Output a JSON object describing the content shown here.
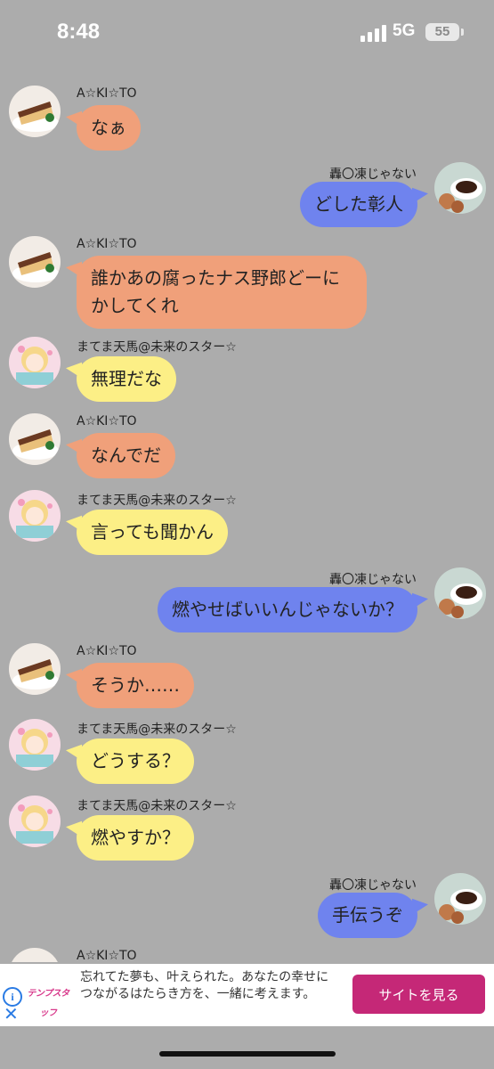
{
  "status_bar": {
    "time": "8:48",
    "network": "5G",
    "battery": "55"
  },
  "chat": {
    "messages": [
      {
        "side": "left",
        "sender": "A☆KI☆TO",
        "avatar": "cake",
        "text": "なぁ",
        "color": "orange"
      },
      {
        "side": "right",
        "sender": "轟〇凍じゃない",
        "avatar": "coffee",
        "text": "どした彰人",
        "color": "blue"
      },
      {
        "side": "left",
        "sender": "A☆KI☆TO",
        "avatar": "cake",
        "text": "誰かあの腐ったナス野郎どーにかしてくれ",
        "color": "orange"
      },
      {
        "side": "left",
        "sender": "まてま天馬@未来のスター☆",
        "avatar": "anime-girl",
        "text": "無理だな",
        "color": "yellow"
      },
      {
        "side": "left",
        "sender": "A☆KI☆TO",
        "avatar": "cake",
        "text": "なんでだ",
        "color": "orange"
      },
      {
        "side": "left",
        "sender": "まてま天馬@未来のスター☆",
        "avatar": "anime-girl",
        "text": "言っても聞かん",
        "color": "yellow"
      },
      {
        "side": "right",
        "sender": "轟〇凍じゃない",
        "avatar": "coffee",
        "text": "燃やせばいいんじゃないか？",
        "color": "blue"
      },
      {
        "side": "left",
        "sender": "A☆KI☆TO",
        "avatar": "cake",
        "text": "そうか……",
        "color": "orange"
      },
      {
        "side": "left",
        "sender": "まてま天馬@未来のスター☆",
        "avatar": "anime-girl",
        "text": "どうする？",
        "color": "yellow"
      },
      {
        "side": "left",
        "sender": "まてま天馬@未来のスター☆",
        "avatar": "anime-girl",
        "text": "燃やすか？",
        "color": "yellow"
      },
      {
        "side": "right",
        "sender": "轟〇凍じゃない",
        "avatar": "coffee",
        "text": "手伝うぞ",
        "color": "blue"
      },
      {
        "side": "left",
        "sender": "A☆KI☆TO",
        "avatar": "cake",
        "text": "",
        "color": "orange"
      }
    ]
  },
  "ad": {
    "logo": "テンプスタッフ",
    "text": "忘れてた夢も、叶えられた。あなたの幸せにつながるはたらき方を、一緒に考えます。",
    "button": "サイトを見る",
    "info_icon": "info-icon",
    "close_icon": "close-icon"
  }
}
